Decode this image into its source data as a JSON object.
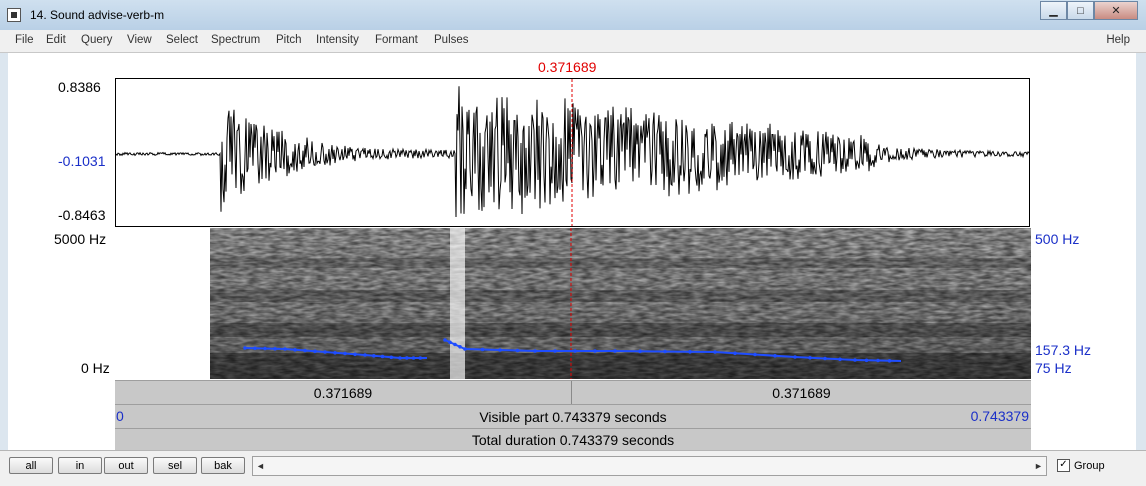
{
  "window": {
    "title": "14. Sound advise-verb-m",
    "minimize_glyph": "▁",
    "maximize_glyph": "□",
    "close_glyph": "✕"
  },
  "menu": {
    "items": [
      "File",
      "Edit",
      "Query",
      "View",
      "Select",
      "Spectrum",
      "Pitch",
      "Intensity",
      "Formant",
      "Pulses"
    ],
    "help": "Help"
  },
  "cursor": {
    "time_label": "0.371689",
    "color": "#e00000"
  },
  "waveform": {
    "max_label": "0.8386",
    "mid_label": "-0.1031",
    "min_label": "-0.8463"
  },
  "spectrogram": {
    "top_freq_label": "5000 Hz",
    "bottom_freq_label": "0 Hz",
    "pitch_top_label": "500 Hz",
    "pitch_value_label": "157.3 Hz",
    "pitch_bottom_label": "75 Hz",
    "pitch_color": "#1f4dff"
  },
  "time_bars": {
    "left_segment": "0.371689",
    "right_segment": "0.371689",
    "visible_start": "0",
    "visible_text": "Visible part 0.743379 seconds",
    "visible_end": "0.743379",
    "total_text": "Total duration 0.743379 seconds"
  },
  "buttons": {
    "all": "all",
    "in": "in",
    "out": "out",
    "sel": "sel",
    "bak": "bak"
  },
  "scrollbar": {
    "left_arrow": "◄",
    "right_arrow": "►"
  },
  "group": {
    "label": "Group",
    "checked": true,
    "check_glyph": "✓"
  }
}
